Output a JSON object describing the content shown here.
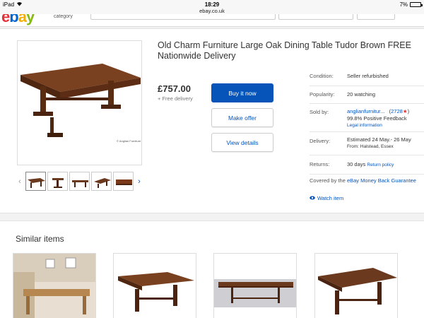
{
  "status_bar": {
    "device": "iPad",
    "time": "18:29",
    "url": "ebay.co.uk",
    "battery": "7%"
  },
  "header": {
    "category_label": "category"
  },
  "listing": {
    "title": "Old Charm Furniture Large Oak Dining Table Tudor Brown FREE Nationwide Delivery",
    "price": "£757.00",
    "delivery_note": "+ Free delivery",
    "photo_watermark": "© Anglian Furniture",
    "thumbnail_count": 5
  },
  "actions": {
    "buy_now": "Buy it now",
    "make_offer": "Make offer",
    "view_details": "View details"
  },
  "details": {
    "condition_label": "Condition:",
    "condition_value": "Seller refurbished",
    "popularity_label": "Popularity:",
    "popularity_value": "20 watching",
    "sold_by_label": "Sold by:",
    "seller_name": "anglianfurnitur...",
    "seller_score": "2728",
    "seller_feedback": "99.8% Positive Feedback",
    "legal_info": "Legal information",
    "delivery_label": "Delivery:",
    "delivery_estimate": "Estimated 24 May.- 26 May",
    "delivery_from": "From: Halstead, Essex",
    "returns_label": "Returns:",
    "returns_value": "30 days",
    "return_policy": "Return policy",
    "covered_prefix": "Covered by the ",
    "covered_link": "eBay Money Back Guarantee",
    "watch_item": "Watch item"
  },
  "similar": {
    "heading": "Similar items"
  },
  "colors": {
    "ebay_blue": "#0654ba",
    "wood": "#6b3a1e",
    "wood_dark": "#4a2410"
  }
}
